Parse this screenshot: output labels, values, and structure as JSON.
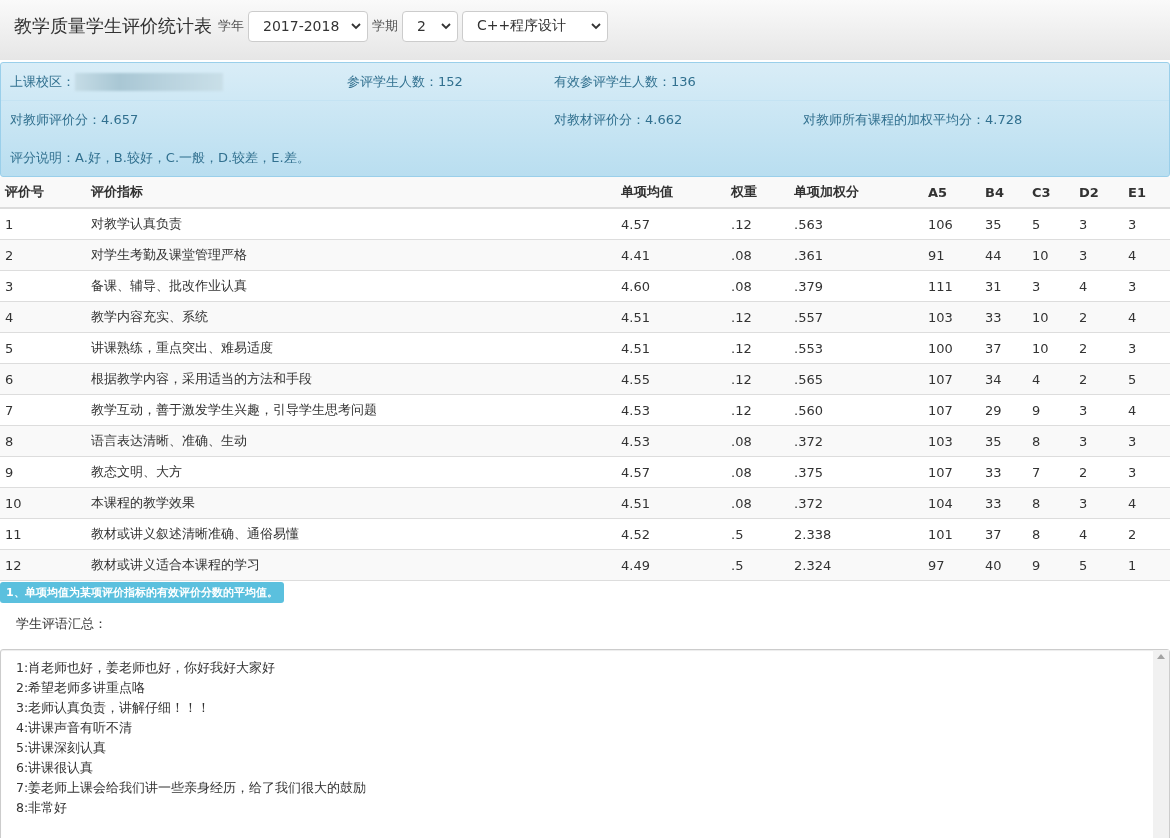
{
  "header": {
    "title": "教学质量学生评价统计表",
    "filters": [
      {
        "label": "学年",
        "value": "2017-2018"
      },
      {
        "label": "学期",
        "value": "2"
      },
      {
        "value": "C++程序设计"
      }
    ]
  },
  "summary": {
    "rows": [
      [
        {
          "label": "上课校区：",
          "redacted": true
        },
        {
          "label": "参评学生人数：",
          "value": "152"
        },
        {
          "label": "有效参评学生人数：",
          "value": "136"
        },
        null
      ],
      [
        {
          "label": "对教师评价分：",
          "value": "4.657"
        },
        null,
        {
          "label": "对教材评价分：",
          "value": "4.662"
        },
        {
          "label": "对教师所有课程的加权平均分：",
          "value": "4.728"
        }
      ],
      [
        {
          "label": "评分说明：",
          "value": "A.好，B.较好，C.一般，D.较差，E.差。"
        },
        null,
        null,
        null
      ]
    ]
  },
  "table": {
    "columns": [
      "评价号",
      "评价指标",
      "单项均值",
      "权重",
      "单项加权分",
      "A5",
      "B4",
      "C3",
      "D2",
      "E1"
    ],
    "rows": [
      [
        "1",
        "对教学认真负责",
        "4.57",
        ".12",
        ".563",
        "106",
        "35",
        "5",
        "3",
        "3"
      ],
      [
        "2",
        "对学生考勤及课堂管理严格",
        "4.41",
        ".08",
        ".361",
        "91",
        "44",
        "10",
        "3",
        "4"
      ],
      [
        "3",
        "备课、辅导、批改作业认真",
        "4.60",
        ".08",
        ".379",
        "111",
        "31",
        "3",
        "4",
        "3"
      ],
      [
        "4",
        "教学内容充实、系统",
        "4.51",
        ".12",
        ".557",
        "103",
        "33",
        "10",
        "2",
        "4"
      ],
      [
        "5",
        "讲课熟练，重点突出、难易适度",
        "4.51",
        ".12",
        ".553",
        "100",
        "37",
        "10",
        "2",
        "3"
      ],
      [
        "6",
        "根据教学内容，采用适当的方法和手段",
        "4.55",
        ".12",
        ".565",
        "107",
        "34",
        "4",
        "2",
        "5"
      ],
      [
        "7",
        "教学互动，善于激发学生兴趣，引导学生思考问题",
        "4.53",
        ".12",
        ".560",
        "107",
        "29",
        "9",
        "3",
        "4"
      ],
      [
        "8",
        "语言表达清晰、准确、生动",
        "4.53",
        ".08",
        ".372",
        "103",
        "35",
        "8",
        "3",
        "3"
      ],
      [
        "9",
        "教态文明、大方",
        "4.57",
        ".08",
        ".375",
        "107",
        "33",
        "7",
        "2",
        "3"
      ],
      [
        "10",
        "本课程的教学效果",
        "4.51",
        ".08",
        ".372",
        "104",
        "33",
        "8",
        "3",
        "4"
      ],
      [
        "11",
        "教材或讲义叙述清晰准确、通俗易懂",
        "4.52",
        ".5",
        "2.338",
        "101",
        "37",
        "8",
        "4",
        "2"
      ],
      [
        "12",
        "教材或讲义适合本课程的学习",
        "4.49",
        ".5",
        "2.324",
        "97",
        "40",
        "9",
        "5",
        "1"
      ]
    ]
  },
  "note": "1、单项均值为某项评价指标的有效评价分数的平均值。",
  "comments": {
    "title": "学生评语汇总：",
    "lines": [
      "1:肖老师也好，姜老师也好，你好我好大家好",
      "2:希望老师多讲重点咯",
      "3:老师认真负责，讲解仔细！！！",
      "4:讲课声音有听不清",
      "5:讲课深刻认真",
      "6:讲课很认真",
      "7:姜老师上课会给我们讲一些亲身经历，给了我们很大的鼓励",
      "8:非常好"
    ]
  }
}
